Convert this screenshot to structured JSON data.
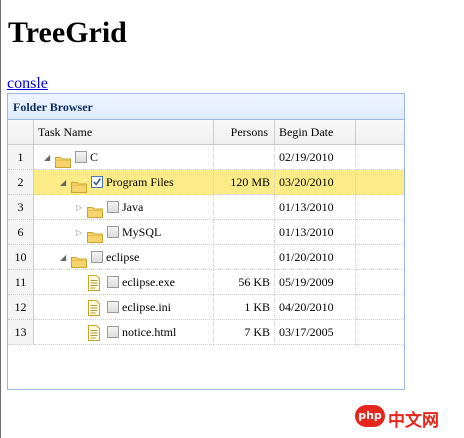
{
  "page": {
    "title": "TreeGrid",
    "console_link": "consle"
  },
  "panel": {
    "title": "Folder Browser"
  },
  "columns": {
    "rownum": "",
    "task_name": "Task Name",
    "persons": "Persons",
    "begin_date": "Begin Date"
  },
  "rows": [
    {
      "num": "1",
      "name": "C",
      "persons": "",
      "date": "02/19/2010",
      "type": "folder",
      "expanded": true,
      "checked": false
    },
    {
      "num": "2",
      "name": "Program Files",
      "persons": "120 MB",
      "date": "03/20/2010",
      "type": "folder",
      "expanded": true,
      "checked": true,
      "selected": true
    },
    {
      "num": "3",
      "name": "Java",
      "persons": "",
      "date": "01/13/2010",
      "type": "folder",
      "expanded": false,
      "checked": false
    },
    {
      "num": "6",
      "name": "MySQL",
      "persons": "",
      "date": "01/13/2010",
      "type": "folder",
      "expanded": false,
      "checked": false
    },
    {
      "num": "10",
      "name": "eclipse",
      "persons": "",
      "date": "01/20/2010",
      "type": "folder",
      "expanded": true,
      "checked": false
    },
    {
      "num": "11",
      "name": "eclipse.exe",
      "persons": "56 KB",
      "date": "05/19/2009",
      "type": "file",
      "checked": false
    },
    {
      "num": "12",
      "name": "eclipse.ini",
      "persons": "1 KB",
      "date": "04/20/2010",
      "type": "file",
      "checked": false
    },
    {
      "num": "13",
      "name": "notice.html",
      "persons": "7 KB",
      "date": "03/17/2005",
      "type": "file",
      "checked": false
    }
  ],
  "watermark": {
    "logo": "php",
    "text": "中文网"
  },
  "colors": {
    "selected_row": "#fbec88",
    "panel_border": "#95b8e7",
    "panel_title": "#0e2d5f",
    "folder": "#f6d46b"
  }
}
